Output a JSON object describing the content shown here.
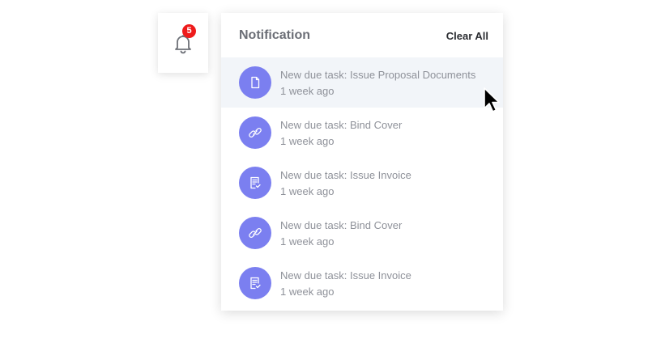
{
  "bell": {
    "icon": "bell-icon",
    "badge_count": "5"
  },
  "panel": {
    "title": "Notification",
    "clear_all_label": "Clear All"
  },
  "notifications": [
    {
      "icon": "document-icon",
      "title": "New due task: Issue Proposal Documents",
      "time": "1 week ago",
      "hovered": true
    },
    {
      "icon": "link-icon",
      "title": "New due task: Bind Cover",
      "time": "1 week ago"
    },
    {
      "icon": "invoice-icon",
      "title": "New due task: Issue Invoice",
      "time": "1 week ago"
    },
    {
      "icon": "link-icon",
      "title": "New due task: Bind Cover",
      "time": "1 week ago"
    },
    {
      "icon": "invoice-icon",
      "title": "New due task: Issue Invoice",
      "time": "1 week ago"
    }
  ],
  "colors": {
    "accent": "#7b7ff0",
    "badge": "#ee1b1b",
    "hover_row": "#f2f5f9"
  }
}
